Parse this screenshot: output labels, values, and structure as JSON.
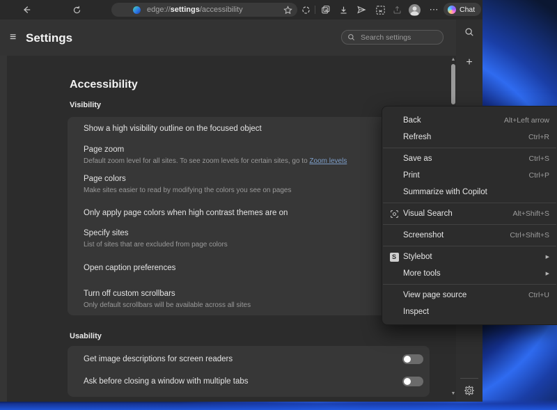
{
  "toolbar": {
    "url": {
      "scheme": "edge://",
      "bold": "settings",
      "rest": "/accessibility"
    },
    "chat_label": "Chat"
  },
  "settings_header": {
    "title": "Settings",
    "search_placeholder": "Search settings"
  },
  "page": {
    "title": "Accessibility",
    "sections": [
      {
        "heading": "Visibility",
        "items": [
          {
            "title": "Show a high visibility outline on the focused object"
          },
          {
            "title": "Page zoom",
            "desc": "Default zoom level for all sites. To see zoom levels for certain sites, go to ",
            "link": "Zoom levels"
          },
          {
            "title": "Page colors",
            "desc": "Make sites easier to read by modifying the colors you see on pages"
          },
          {
            "title": "Only apply page colors when high contrast themes are on"
          },
          {
            "title": "Specify sites",
            "desc": "List of sites that are excluded from page colors"
          },
          {
            "title": "Open caption preferences"
          },
          {
            "title": "Turn off custom scrollbars",
            "desc": "Only default scrollbars will be available across all sites"
          }
        ]
      },
      {
        "heading": "Usability",
        "items": [
          {
            "title": "Get image descriptions for screen readers",
            "toggle": "off"
          },
          {
            "title": "Ask before closing a window with multiple tabs",
            "toggle": "off"
          }
        ]
      }
    ]
  },
  "context_menu": {
    "groups": [
      {
        "items": [
          {
            "label": "Back",
            "shortcut": "Alt+Left arrow"
          },
          {
            "label": "Refresh",
            "shortcut": "Ctrl+R"
          }
        ]
      },
      {
        "items": [
          {
            "label": "Save as",
            "shortcut": "Ctrl+S"
          },
          {
            "label": "Print",
            "shortcut": "Ctrl+P"
          },
          {
            "label": "Summarize with Copilot"
          }
        ]
      },
      {
        "items": [
          {
            "label": "Visual Search",
            "shortcut": "Alt+Shift+S",
            "icon": "visual-search"
          }
        ]
      },
      {
        "items": [
          {
            "label": "Screenshot",
            "shortcut": "Ctrl+Shift+S"
          }
        ]
      },
      {
        "items": [
          {
            "label": "Stylebot",
            "icon": "stylebot",
            "submenu": true
          },
          {
            "label": "More tools",
            "submenu": true
          }
        ]
      },
      {
        "items": [
          {
            "label": "View page source",
            "shortcut": "Ctrl+U"
          },
          {
            "label": "Inspect"
          }
        ]
      }
    ]
  },
  "icons": {
    "hamburger": "≡",
    "more": "⋯",
    "plus": "+",
    "submenu_arrow": "▶",
    "scroll_up": "▲",
    "scroll_down": "▼",
    "stylebot_letter": "S"
  },
  "colors": {
    "link": "#7d9ec9",
    "menu_bg": "#2c2c2c",
    "card_bg": "#373737",
    "toggle_track": "#6b6b6b",
    "toggle_knob": "#ffffff",
    "wallpaper_blue": "#2f6bf0"
  }
}
